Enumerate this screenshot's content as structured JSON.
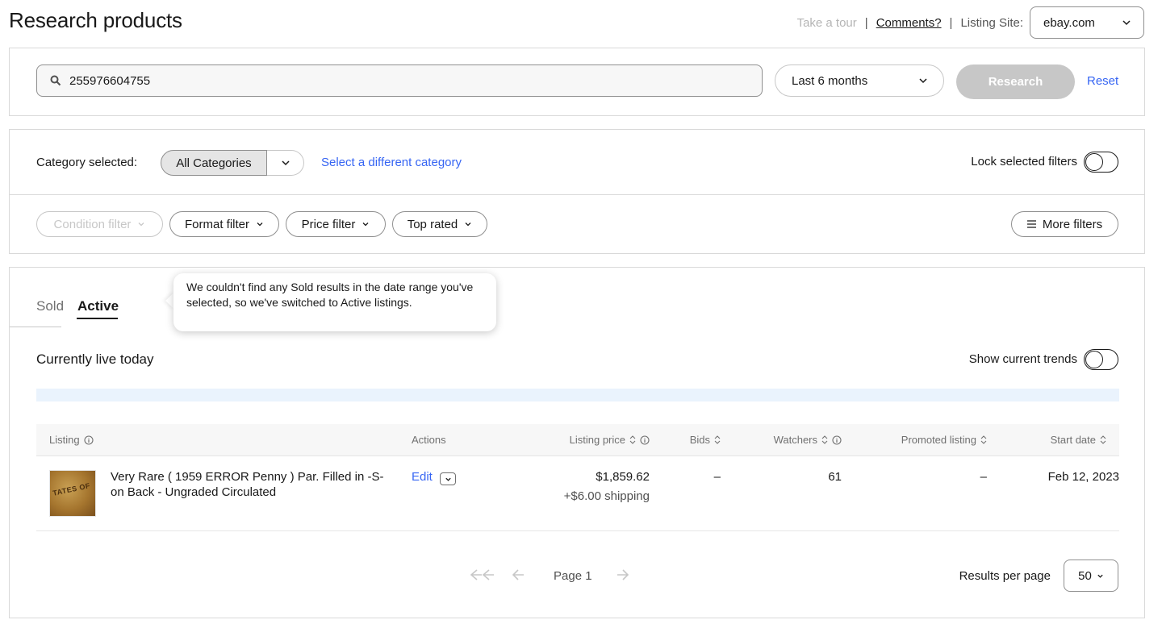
{
  "header": {
    "title": "Research products",
    "tour_label": "Take a tour",
    "comments_label": "Comments?",
    "listing_site_label": "Listing Site:",
    "listing_site_value": "ebay.com"
  },
  "search": {
    "query": "255976604755",
    "date_range": "Last 6 months",
    "research_label": "Research",
    "reset_label": "Reset"
  },
  "filters": {
    "category_label": "Category selected:",
    "category_value": "All Categories",
    "different_category_label": "Select a different category",
    "lock_label": "Lock selected filters",
    "condition_label": "Condition filter",
    "format_label": "Format filter",
    "price_label": "Price filter",
    "top_rated_label": "Top rated",
    "more_filters_label": "More filters"
  },
  "results": {
    "tabs": [
      {
        "label": "Sold"
      },
      {
        "label": "Active"
      }
    ],
    "tooltip": "We couldn't find any Sold results in the date range you've selected, so we've switched to Active listings.",
    "section_title": "Currently live today",
    "trends_label": "Show current trends",
    "columns": {
      "listing": "Listing",
      "actions": "Actions",
      "listing_price": "Listing price",
      "bids": "Bids",
      "watchers": "Watchers",
      "promoted": "Promoted listing",
      "start_date": "Start date"
    },
    "rows": [
      {
        "title": "Very Rare ( 1959 ERROR Penny ) Par. Filled in -S- on Back - Ungraded Circulated",
        "action": "Edit",
        "price": "$1,859.62",
        "shipping": "+$6.00 shipping",
        "bids": "–",
        "watchers": "61",
        "promoted": "–",
        "start_date": "Feb 12, 2023"
      }
    ],
    "pagination": {
      "page_label": "Page 1",
      "results_per_page_label": "Results per page",
      "results_per_page_value": "50"
    }
  },
  "colors": {
    "link": "#3665f3",
    "disabled": "#c7c7c7",
    "info_bar": "#eaf3fd"
  }
}
